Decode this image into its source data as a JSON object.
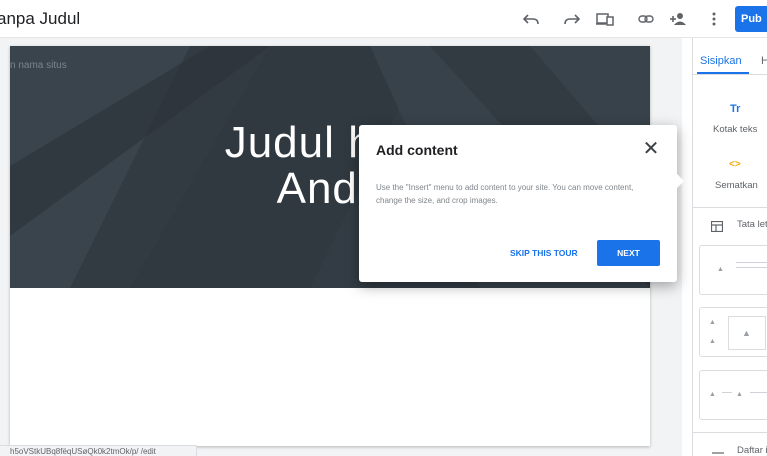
{
  "header": {
    "doc_title": "anpa Judul",
    "icons": [
      "undo-icon",
      "redo-icon",
      "preview-devices-icon",
      "link-icon",
      "share-add-person-icon",
      "more-vert-icon"
    ],
    "publish_label": "Pub"
  },
  "page": {
    "site_name": "n nama situs",
    "hero_title": "Judul hala\nAnda"
  },
  "dialog": {
    "title": "Add content",
    "body": "Use the \"Insert\" menu to add content to your site. You can move content, change the size, and crop images.",
    "skip_label": "SKIP THIS TOUR",
    "next_label": "NEXT"
  },
  "sidebar": {
    "tabs": [
      {
        "label": "Sisipkan",
        "active": true
      },
      {
        "label": "H",
        "active": false
      }
    ],
    "items": [
      {
        "label": "Kotak teks",
        "icon": "text-box-icon",
        "glyph": "Tr"
      },
      {
        "label": "Sematkan",
        "icon": "embed-icon",
        "glyph": "<>"
      }
    ],
    "layouts_label": "Tata let",
    "bottom_label": "Daftar i"
  },
  "status": {
    "url": "h5oVStkUBq8fëqUSøQk0k2tmOk/p/ /edit"
  },
  "colors": {
    "accent": "#1a73e8",
    "hero_bg": "#333c44",
    "embed_icon": "#f9ab00"
  }
}
